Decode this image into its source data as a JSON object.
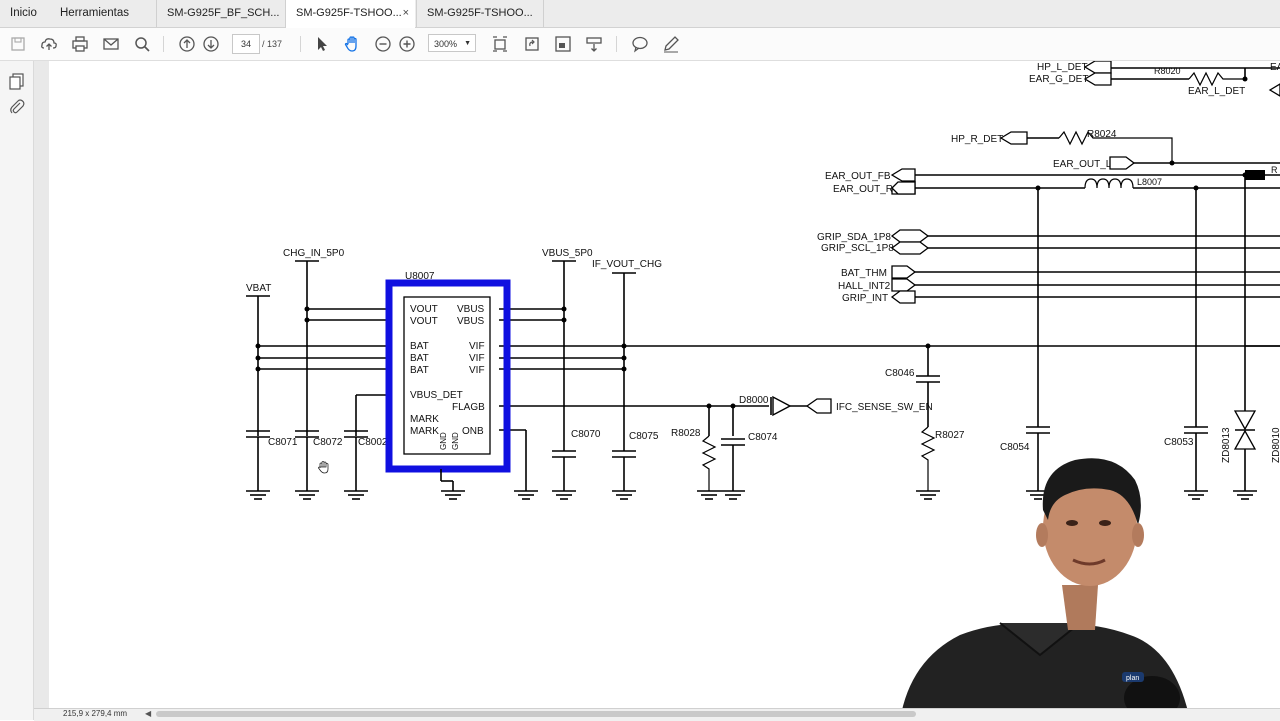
{
  "tabs": {
    "home": "Inicio",
    "tools": "Herramientas",
    "docs": [
      {
        "label": "SM-G925F_BF_SCH...",
        "active": false,
        "close": ""
      },
      {
        "label": "SM-G925F-TSHOO...",
        "active": true,
        "close": "×"
      },
      {
        "label": "SM-G925F-TSHOO...",
        "active": false,
        "close": ""
      }
    ]
  },
  "toolbar": {
    "page_current": "34",
    "page_total": "/ 137",
    "zoom": "300%",
    "icons": [
      "save-icon",
      "cloud-upload-icon",
      "print-icon",
      "email-icon",
      "search-icon",
      "page-up-icon",
      "page-down-icon",
      "select-arrow-icon",
      "hand-tool-icon",
      "zoom-out-icon",
      "zoom-in-icon",
      "fit-width-icon",
      "rotate-icon",
      "full-screen-icon",
      "scroll-mode-icon",
      "comment-icon",
      "pen-icon"
    ]
  },
  "left_panel": {
    "icons": [
      "pages-icon",
      "attachment-icon"
    ],
    "collapse": "◀"
  },
  "status": {
    "page_size": "215,9 x 279,4 mm",
    "scroll_left": "◀"
  },
  "schematic": {
    "chip": {
      "ref": "U8007",
      "left_pins": [
        "VOUT",
        "VOUT",
        "BAT",
        "BAT",
        "BAT",
        "VBUS_DET",
        "MARK",
        "MARK"
      ],
      "right_pins": [
        "VBUS",
        "VBUS",
        "VIF",
        "VIF",
        "VIF",
        "FLAGB",
        "ONB"
      ],
      "bottom_pins": [
        "GND",
        "GND"
      ],
      "highlight_color": "#1010e0"
    },
    "power_labels": [
      "VBAT",
      "CHG_IN_5P0",
      "VBUS_5P0",
      "IF_VOUT_CHG"
    ],
    "capacitors": [
      "C8071",
      "C8072",
      "C8002",
      "C8070",
      "C8075",
      "C8074",
      "C8046",
      "C8054",
      "C8053"
    ],
    "resistors": [
      "R8028",
      "R8027",
      "R8020",
      "R8024"
    ],
    "diode": "D8000",
    "zener": "ZD8013",
    "zener2": "ZD8010",
    "inductor": "L8007",
    "net_labels": [
      "HP_L_DET",
      "EAR_G_DET",
      "EAR_L_DET",
      "HP_R_DET",
      "EAR_OUT_L",
      "EAR_OUT_FB",
      "EAR_OUT_R",
      "GRIP_SDA_1P8",
      "GRIP_SCL_1P8",
      "BAT_THM",
      "HALL_INT2",
      "GRIP_INT",
      "IFC_SENSE_SW_EN"
    ],
    "edge_fragments": [
      "EA",
      "R"
    ]
  },
  "webcam": {
    "logo": "plan"
  }
}
